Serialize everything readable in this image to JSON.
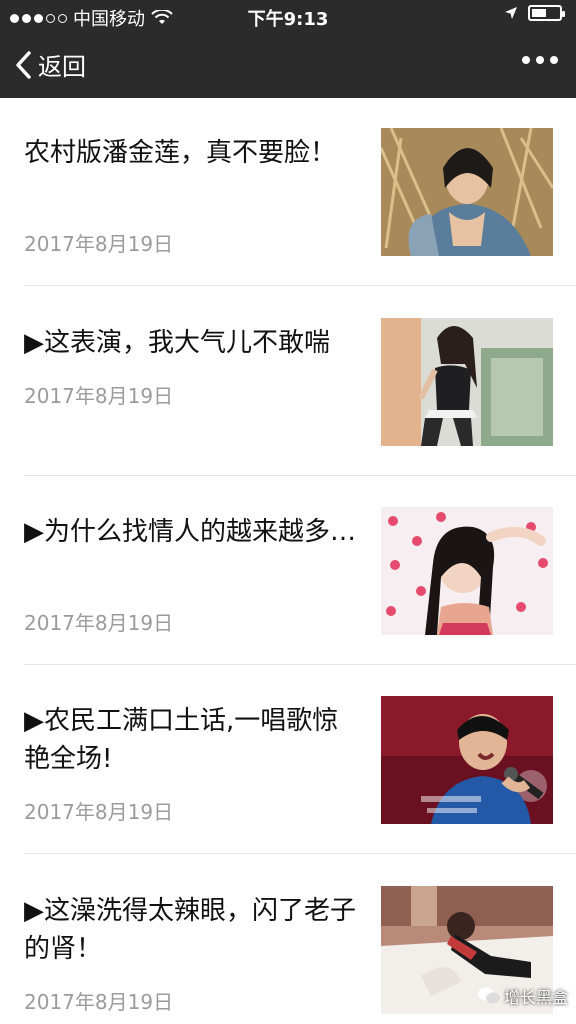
{
  "status_bar": {
    "carrier": "中国移动",
    "time": "下午9:13"
  },
  "nav": {
    "back_label": "返回"
  },
  "articles": [
    {
      "title": "农村版潘金莲，真不要脸！",
      "date": "2017年8月19日",
      "thumb_icon": "photo-woman-in-haystack"
    },
    {
      "title": "▶这表演，我大气儿不敢喘",
      "date": "2017年8月19日",
      "thumb_icon": "photo-woman-posing"
    },
    {
      "title": "▶为什么找情人的越来越多…",
      "date": "2017年8月19日",
      "thumb_icon": "photo-girl-polka-dots"
    },
    {
      "title": "▶农民工满口土话,一唱歌惊艳全场!",
      "date": "2017年8月19日",
      "thumb_icon": "photo-man-singing"
    },
    {
      "title": "▶这澡洗得太辣眼，闪了老子的肾！",
      "date": "2017年8月19日",
      "thumb_icon": "photo-woman-on-bed"
    }
  ],
  "watermark": {
    "text": "增长黑盒"
  },
  "colors": {
    "bar": "#2b2b2b",
    "date": "#9b9b9b",
    "divider": "#e5e5e5"
  }
}
